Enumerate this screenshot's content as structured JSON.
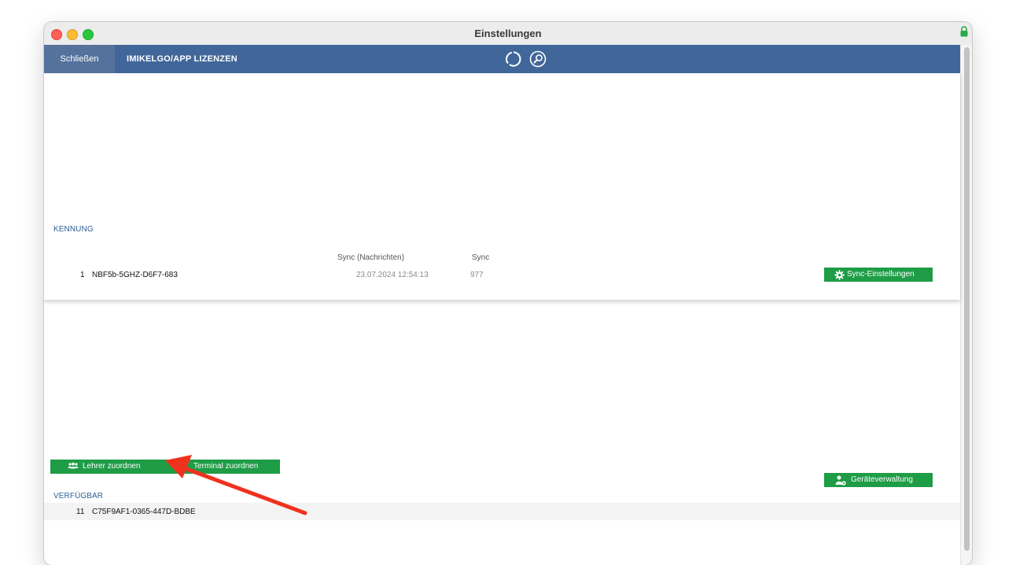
{
  "window": {
    "title": "Einstellungen"
  },
  "toolbar": {
    "close_label": "Schließen",
    "section_label": "IMIKELGO/APP LIZENZEN",
    "sync_icon": "sync-icon",
    "search_icon": "search-icon"
  },
  "kennung": {
    "label": "KENNUNG",
    "columns": {
      "sync_messages": "Sync (Nachrichten)",
      "sync": "Sync"
    },
    "rows": [
      {
        "num": "1",
        "id": "NBF5b-5GHZ-D6F7-683",
        "sync_time": "23.07.2024 12:54:13",
        "sync_count": "977"
      }
    ],
    "sync_settings_button": "Sync-Einstellungen"
  },
  "assign": {
    "teacher_button": "Lehrer zuordnen",
    "terminal_button": "Terminal zuordnen",
    "device_button": "Geräteverwaltung"
  },
  "available": {
    "label": "VERFÜGBAR",
    "rows": [
      {
        "num": "11",
        "id": "C75F9AF1-0365-447D-BDBE"
      }
    ]
  },
  "colors": {
    "toolbar_bg": "#41669a",
    "button_green": "#1e9c46",
    "section_label": "#2d5f92",
    "annotation_arrow": "#f0311e"
  }
}
